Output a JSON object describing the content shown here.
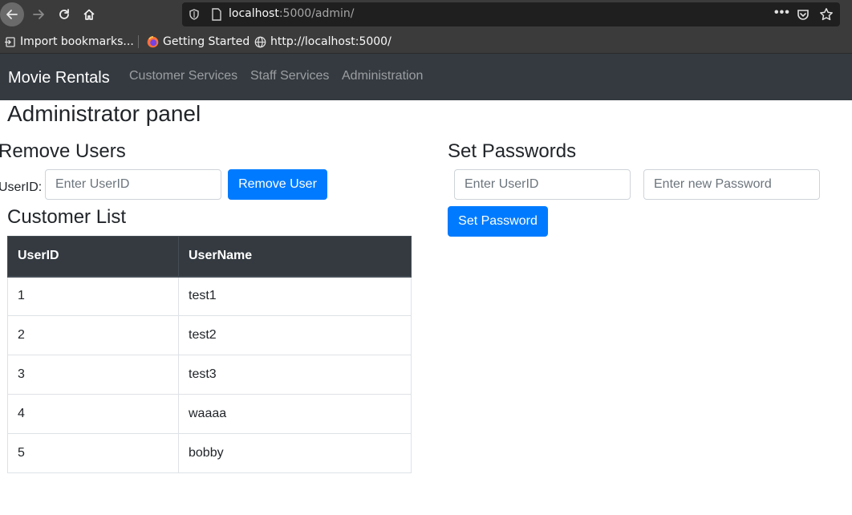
{
  "browser": {
    "url_host": "localhost",
    "url_rest": ":5000/admin/",
    "more_label": "•••",
    "bookmarks": [
      {
        "label": "Import bookmarks..."
      },
      {
        "label": "Getting Started"
      },
      {
        "label": "http://localhost:5000/"
      }
    ]
  },
  "navbar": {
    "brand": "Movie Rentals",
    "links": [
      {
        "label": "Customer Services"
      },
      {
        "label": "Staff Services"
      },
      {
        "label": "Administration"
      }
    ]
  },
  "page": {
    "title": "Administrator panel",
    "remove_users": {
      "title": "Remove Users",
      "userid_label": "UserID:",
      "userid_placeholder": "Enter UserID",
      "button_label": "Remove User"
    },
    "set_passwords": {
      "title": "Set Passwords",
      "userid_placeholder": "Enter UserID",
      "password_placeholder": "Enter new Password",
      "button_label": "Set Password"
    },
    "customer_list": {
      "title": "Customer List",
      "columns": [
        "UserID",
        "UserName"
      ],
      "rows": [
        {
          "id": "1",
          "name": "test1"
        },
        {
          "id": "2",
          "name": "test2"
        },
        {
          "id": "3",
          "name": "test3"
        },
        {
          "id": "4",
          "name": "waaaa"
        },
        {
          "id": "5",
          "name": "bobby"
        }
      ]
    }
  },
  "colors": {
    "navbar_bg": "#343a40",
    "primary": "#007bff",
    "browser_chrome": "#3b3b3b"
  }
}
